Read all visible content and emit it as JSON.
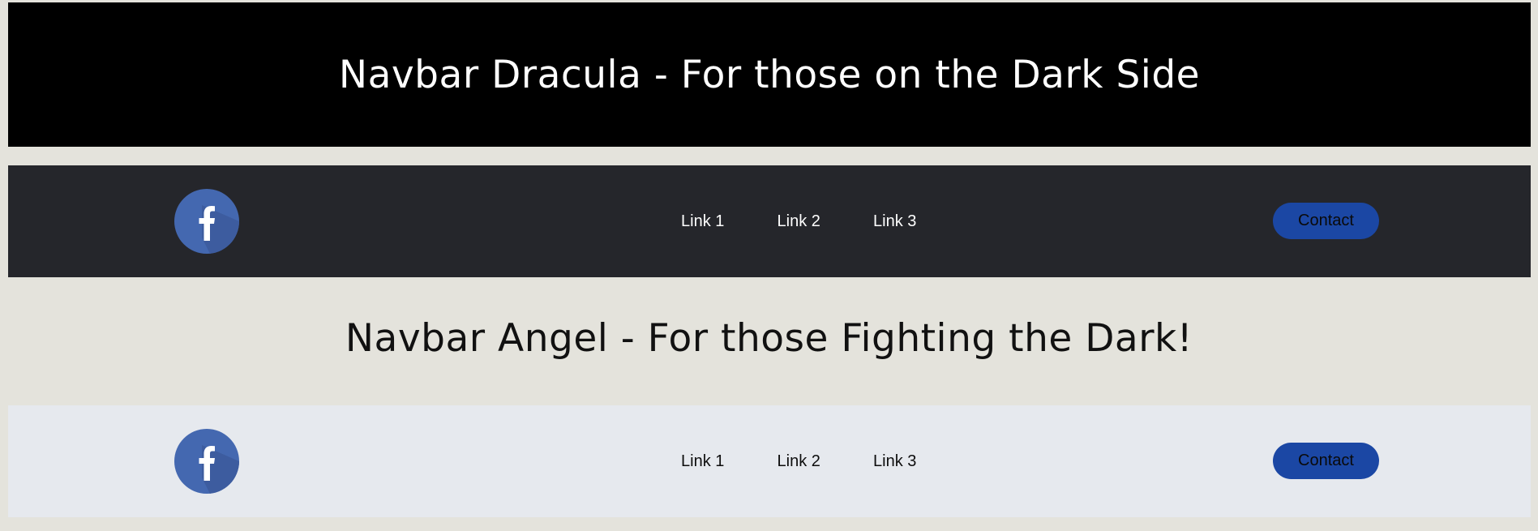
{
  "dracula": {
    "title": "Navbar Dracula - For those on the Dark Side",
    "background_color": "#000000",
    "navbar": {
      "background_color": "#25262b",
      "logo_icon": "facebook-icon",
      "links": [
        {
          "label": "Link 1"
        },
        {
          "label": "Link 2"
        },
        {
          "label": "Link 3"
        }
      ],
      "contact_label": "Contact"
    }
  },
  "angel": {
    "title": "Navbar Angel - For those Fighting the Dark!",
    "navbar": {
      "background_color": "#e6e9ee",
      "logo_icon": "facebook-icon",
      "links": [
        {
          "label": "Link 1"
        },
        {
          "label": "Link 2"
        },
        {
          "label": "Link 3"
        }
      ],
      "contact_label": "Contact"
    }
  },
  "colors": {
    "page_background": "#e4e3dc",
    "facebook_blue": "#4468b0",
    "contact_button": "#1b47a4"
  }
}
